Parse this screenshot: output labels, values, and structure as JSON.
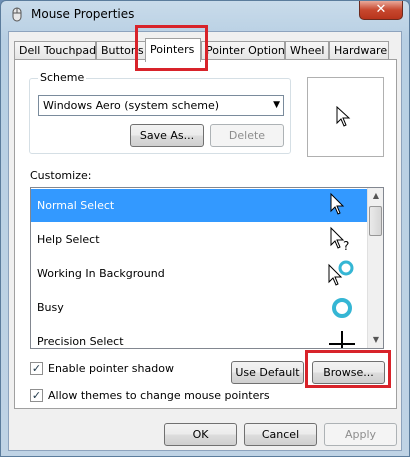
{
  "window": {
    "title": "Mouse Properties",
    "close_symbol": "✕"
  },
  "tabs": [
    {
      "label": "Dell Touchpad"
    },
    {
      "label": "Buttons"
    },
    {
      "label": "Pointers"
    },
    {
      "label": "Pointer Options"
    },
    {
      "label": "Wheel"
    },
    {
      "label": "Hardware"
    }
  ],
  "scheme": {
    "group_label": "Scheme",
    "selected": "Windows Aero (system scheme)",
    "save_as_label": "Save As...",
    "delete_label": "Delete"
  },
  "customize": {
    "label": "Customize:",
    "items": [
      {
        "label": "Normal Select",
        "icon": "arrow-cursor-icon"
      },
      {
        "label": "Help Select",
        "icon": "help-cursor-icon"
      },
      {
        "label": "Working In Background",
        "icon": "working-cursor-icon"
      },
      {
        "label": "Busy",
        "icon": "busy-cursor-icon"
      },
      {
        "label": "Precision Select",
        "icon": "crosshair-cursor-icon"
      }
    ]
  },
  "options": {
    "pointer_shadow_label": "Enable pointer shadow",
    "pointer_shadow_checked": true,
    "use_default_label": "Use Default",
    "browse_label": "Browse...",
    "allow_themes_label": "Allow themes to change mouse pointers",
    "allow_themes_checked": true
  },
  "footer": {
    "ok_label": "OK",
    "cancel_label": "Cancel",
    "apply_label": "Apply"
  },
  "colors": {
    "selection": "#3399ff",
    "highlight_box": "#d8232a"
  }
}
